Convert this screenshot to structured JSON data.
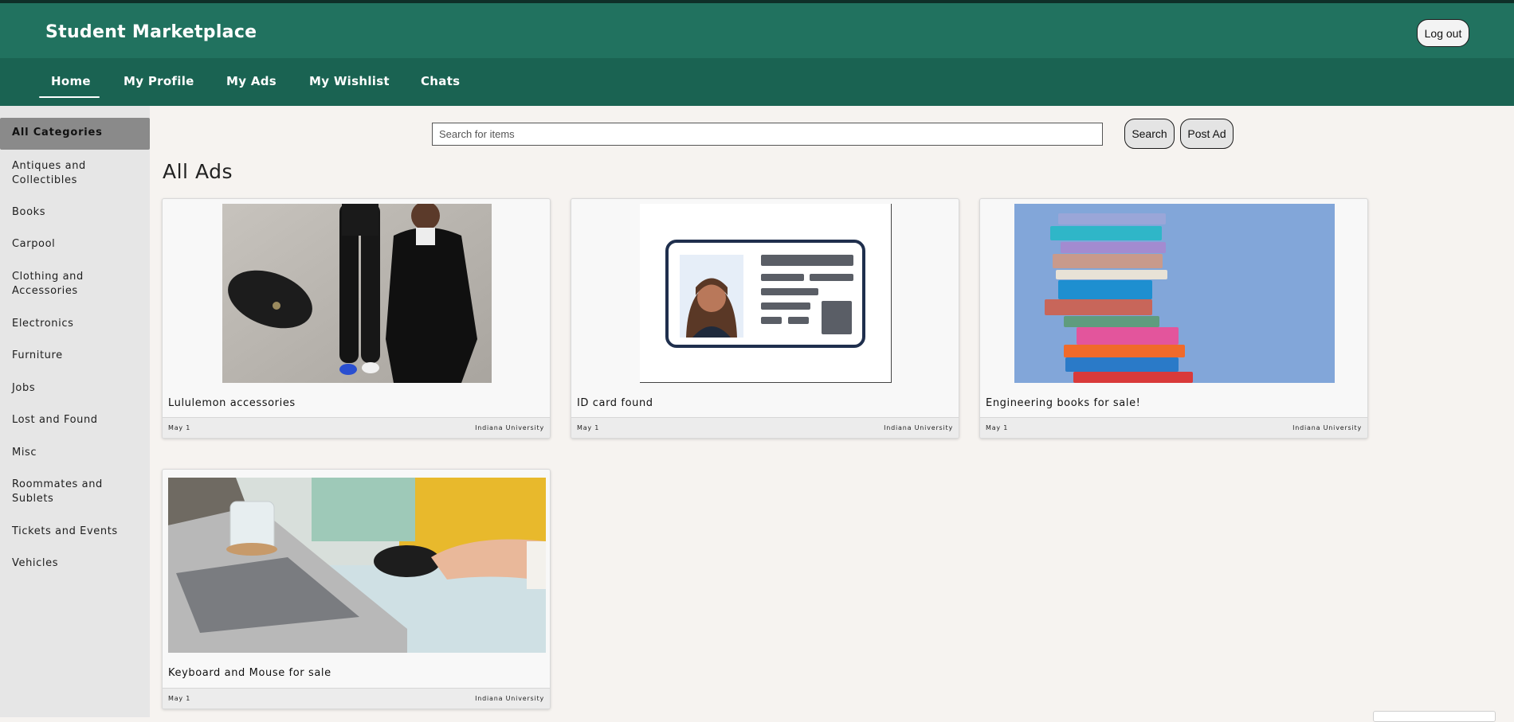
{
  "app": {
    "title": "Student Marketplace",
    "logout_label": "Log out"
  },
  "nav": {
    "items": [
      {
        "label": "Home",
        "active": true
      },
      {
        "label": "My Profile"
      },
      {
        "label": "My Ads"
      },
      {
        "label": "My Wishlist"
      },
      {
        "label": "Chats"
      }
    ]
  },
  "sidebar": {
    "active_label": "All Categories",
    "categories": [
      "Antiques and Collectibles",
      "Books",
      "Carpool",
      "Clothing and Accessories",
      "Electronics",
      "Furniture",
      "Jobs",
      "Lost and Found",
      "Misc",
      "Roommates and Sublets",
      "Tickets and Events",
      "Vehicles"
    ]
  },
  "search": {
    "placeholder": "Search for items",
    "value": "",
    "search_label": "Search",
    "post_label": "Post Ad"
  },
  "main": {
    "heading": "All Ads"
  },
  "ads": [
    {
      "title": "Lululemon accessories",
      "date": "May 1",
      "school": "Indiana University",
      "image": "clothing-photo"
    },
    {
      "title": "ID card found",
      "date": "May 1",
      "school": "Indiana University",
      "image": "id-card-illustration"
    },
    {
      "title": "Engineering books for sale!",
      "date": "May 1",
      "school": "Indiana University",
      "image": "book-stack-photo"
    },
    {
      "title": "Keyboard and Mouse for sale",
      "date": "May 1",
      "school": "Indiana University",
      "image": "laptop-mouse-photo"
    }
  ],
  "colors": {
    "header": "#21725f",
    "nav": "#1a6352",
    "sidebar": "#e6e6e6",
    "active_category": "#8a8a8a",
    "page_bg": "#f6f3f0"
  }
}
